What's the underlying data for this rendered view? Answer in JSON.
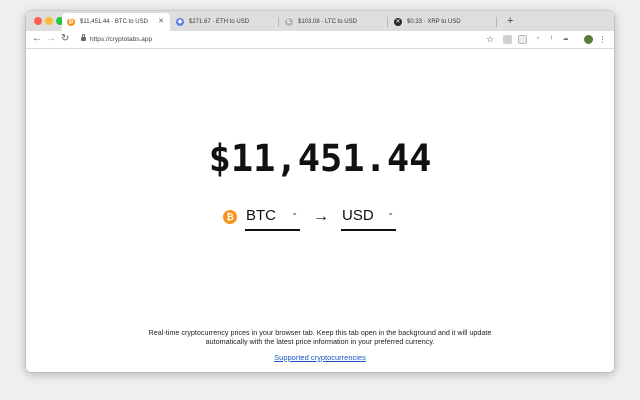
{
  "colors": {
    "btc": "#f7931a",
    "eth": "#627eea",
    "ltc": "#b5b5b5",
    "xrp": "#23292f",
    "link": "#1a55c8"
  },
  "tabs": [
    {
      "label": "$11,451.44 · BTC to USD",
      "icon": "bitcoin-icon",
      "glyph": "₿",
      "active": true
    },
    {
      "label": "$271.67 · ETH to USD",
      "icon": "ethereum-icon",
      "glyph": "◆",
      "active": false
    },
    {
      "label": "$103.08 · LTC to USD",
      "icon": "litecoin-icon",
      "glyph": "Ł",
      "active": false
    },
    {
      "label": "$0.33 · XRP to USD",
      "icon": "xrp-icon",
      "glyph": "✕",
      "active": false
    }
  ],
  "address_bar": {
    "url": "https://cryptotabs.app"
  },
  "main": {
    "price": "$11,451.44",
    "from_currency": "BTC",
    "coin_glyph": "₿",
    "arrow": "→",
    "to_currency": "USD",
    "description": "Real-time cryptocurrency prices in your browser tab. Keep this tab open in the background and it will update automatically with the latest price information in your preferred currency.",
    "link_text": "Supported cryptocurrencies"
  }
}
